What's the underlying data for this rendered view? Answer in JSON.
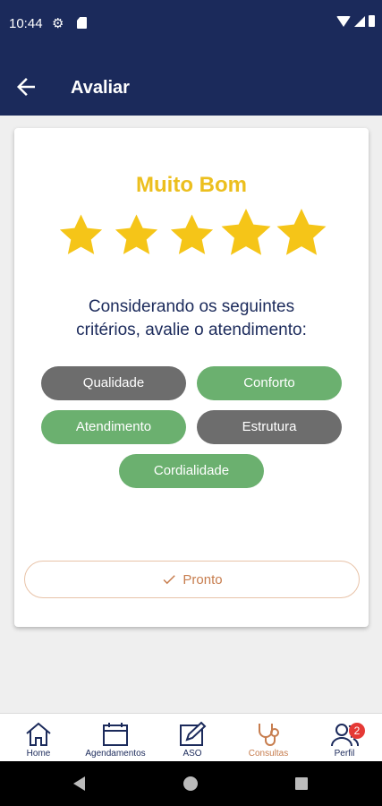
{
  "status_bar": {
    "time": "10:44"
  },
  "header": {
    "title": "Avaliar"
  },
  "rating": {
    "label": "Muito Bom",
    "value": 5,
    "max": 5,
    "star_color": "#f5c518"
  },
  "question": {
    "line1": "Considerando os seguintes",
    "line2": "critérios, avalie o atendimento:"
  },
  "criteria": [
    {
      "label": "Qualidade",
      "selected": false
    },
    {
      "label": "Conforto",
      "selected": true
    },
    {
      "label": "Atendimento",
      "selected": true
    },
    {
      "label": "Estrutura",
      "selected": false
    },
    {
      "label": "Cordialidade",
      "selected": true
    }
  ],
  "done_button": {
    "label": "Pronto"
  },
  "bottom_nav": {
    "items": [
      {
        "label": "Home",
        "icon": "home-icon"
      },
      {
        "label": "Agendamentos",
        "icon": "calendar-icon"
      },
      {
        "label": "ASO",
        "icon": "edit-document-icon"
      },
      {
        "label": "Consultas",
        "icon": "stethoscope-icon",
        "active": true
      },
      {
        "label": "Perfil",
        "icon": "user-group-icon",
        "badge": "2"
      }
    ]
  },
  "colors": {
    "primary": "#1b2a5b",
    "accent": "#c77d4e",
    "rating": "#ecbf1e",
    "chip_selected": "#6bb06f",
    "chip_unselected": "#6d6d6d",
    "badge": "#e53935"
  }
}
